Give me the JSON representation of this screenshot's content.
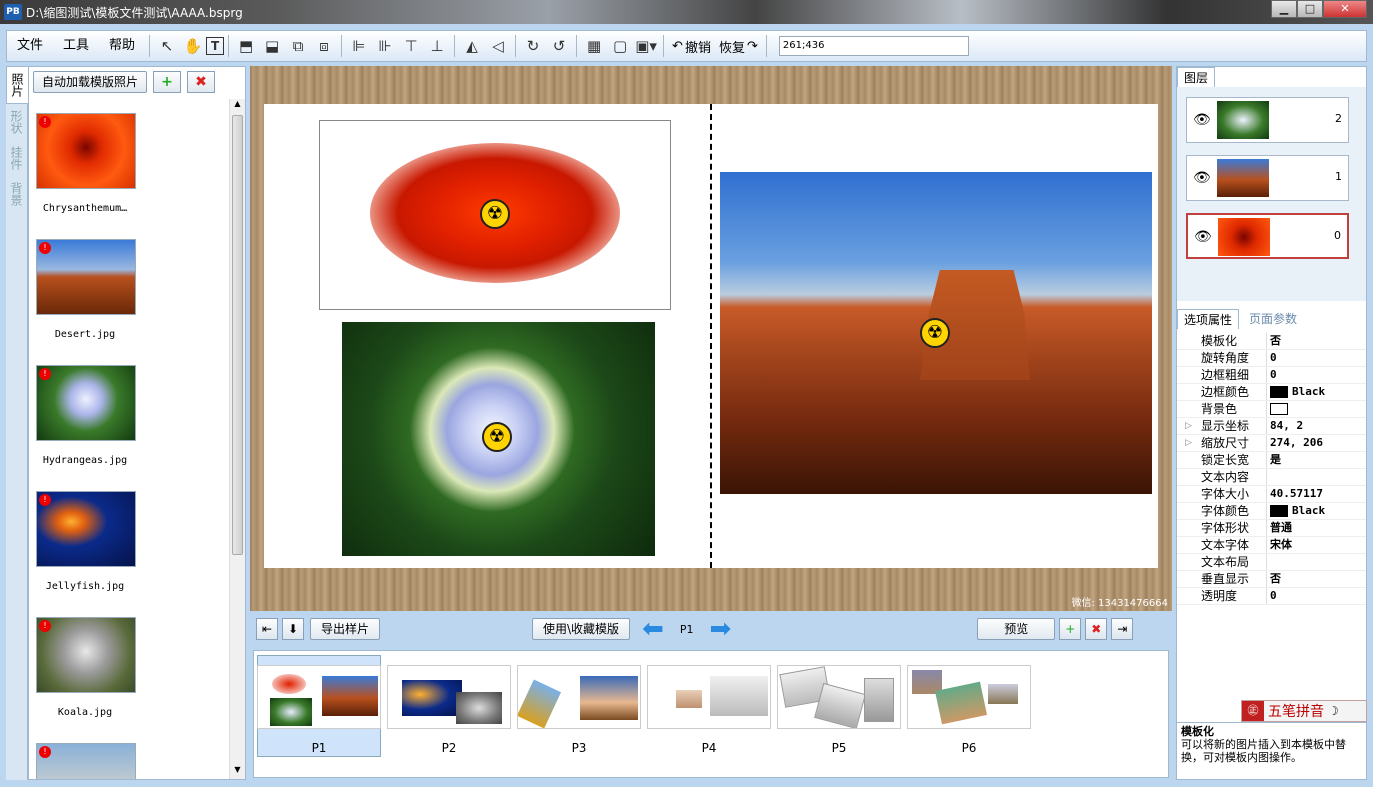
{
  "window": {
    "title": "D:\\缩图测试\\模板文件测试\\AAAA.bsprg",
    "app_icon": "PB",
    "min": "▁",
    "max": "□",
    "close": "✕"
  },
  "menu": [
    "文件",
    "工具",
    "帮助"
  ],
  "toolbar": {
    "undo": "撤销",
    "redo": "恢复",
    "coords": "261;436"
  },
  "left_tabs": [
    "照片",
    "形状",
    "挂件",
    "背景"
  ],
  "left_panel": {
    "auto_load": "自动加载模版照片",
    "add": "+",
    "remove": "✖",
    "photos": [
      "Chrysanthemum…",
      "Desert.jpg",
      "Hydrangeas.jpg",
      "Jellyfish.jpg",
      "Koala.jpg"
    ]
  },
  "canvas": {
    "watermark": "微信: 13431476664"
  },
  "nav": {
    "export": "导出样片",
    "use_template": "使用\\收藏模版",
    "page": "P1",
    "preview": "预览"
  },
  "pages": [
    "P1",
    "P2",
    "P3",
    "P4",
    "P5",
    "P6"
  ],
  "right_panel": {
    "layers_tab": "图层",
    "layers": [
      "2",
      "1",
      "0"
    ],
    "props_tab": "选项属性",
    "page_tab": "页面参数",
    "props": [
      {
        "name": "模板化",
        "value": "否"
      },
      {
        "name": "旋转角度",
        "value": "0"
      },
      {
        "name": "边框粗细",
        "value": "0"
      },
      {
        "name": "边框颜色",
        "value": "Black",
        "swatch": "#000000"
      },
      {
        "name": "背景色",
        "value": "",
        "swatch": "#ffffff"
      },
      {
        "name": "显示坐标",
        "value": "84, 2",
        "expand": "▷"
      },
      {
        "name": "缩放尺寸",
        "value": "274, 206",
        "expand": "▷"
      },
      {
        "name": "锁定长宽",
        "value": "是"
      },
      {
        "name": "文本内容",
        "value": ""
      },
      {
        "name": "字体大小",
        "value": "40.57117"
      },
      {
        "name": "字体颜色",
        "value": "Black",
        "swatch": "#000000"
      },
      {
        "name": "字体形状",
        "value": "普通"
      },
      {
        "name": "文本字体",
        "value": "宋体"
      },
      {
        "name": "文本布局",
        "value": ""
      },
      {
        "name": "垂直显示",
        "value": "否"
      },
      {
        "name": "透明度",
        "value": "0"
      }
    ],
    "help_title": "模板化",
    "help_text": "可以将新的图片插入到本模板中替换，可对模板内图操作。"
  },
  "ime": {
    "logo": "㊣",
    "text": "五笔拼音",
    "moon": "☽"
  }
}
